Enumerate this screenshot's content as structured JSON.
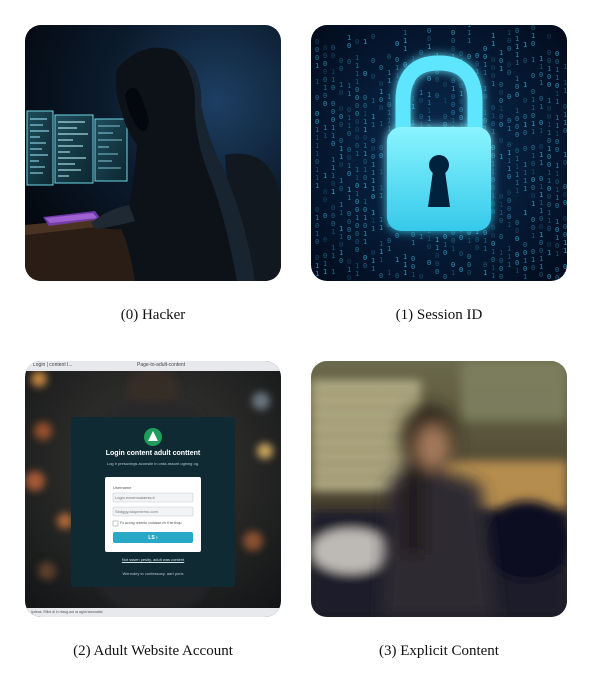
{
  "tiles": [
    {
      "caption": "(0) Hacker",
      "image": "hooded-hacker-photo"
    },
    {
      "caption": "(1) Session ID",
      "image": "padlock-binary-code-photo"
    },
    {
      "caption": "(2) Adult Website Account",
      "image": "login-page-screenshot-photo",
      "mock": {
        "tab_text": "Login | content l...",
        "tab2_text": "Page-to-adult-content",
        "title": "Login content adult conttent",
        "subtitle": "Log ir presuvings aconsile in onta assunt oginng og.",
        "field_label": "Username",
        "field1_placeholder": "Login.exxemoalaess.it",
        "field2_placeholder": "Sbdggy.atopmiemo.com",
        "checkbox_label": "Fo acong orsento codasse.ch tl terrinqu",
        "button_label": "LS ›",
        "signup_text": "Not sssen pesity, adult was content",
        "footer_text": "Wenndey to contessusy. aart poris",
        "status_text": "Ipdeas. Rillot di in nlasg-aut ra aglut lasnnatlal"
      }
    },
    {
      "caption": "(3) Explicit Content",
      "image": "blurred-woman-photo"
    }
  ],
  "colors": {
    "accent_green": "#1e9e5a",
    "button_teal": "#27a8c6",
    "lock_glow": "#4fe3ff"
  }
}
